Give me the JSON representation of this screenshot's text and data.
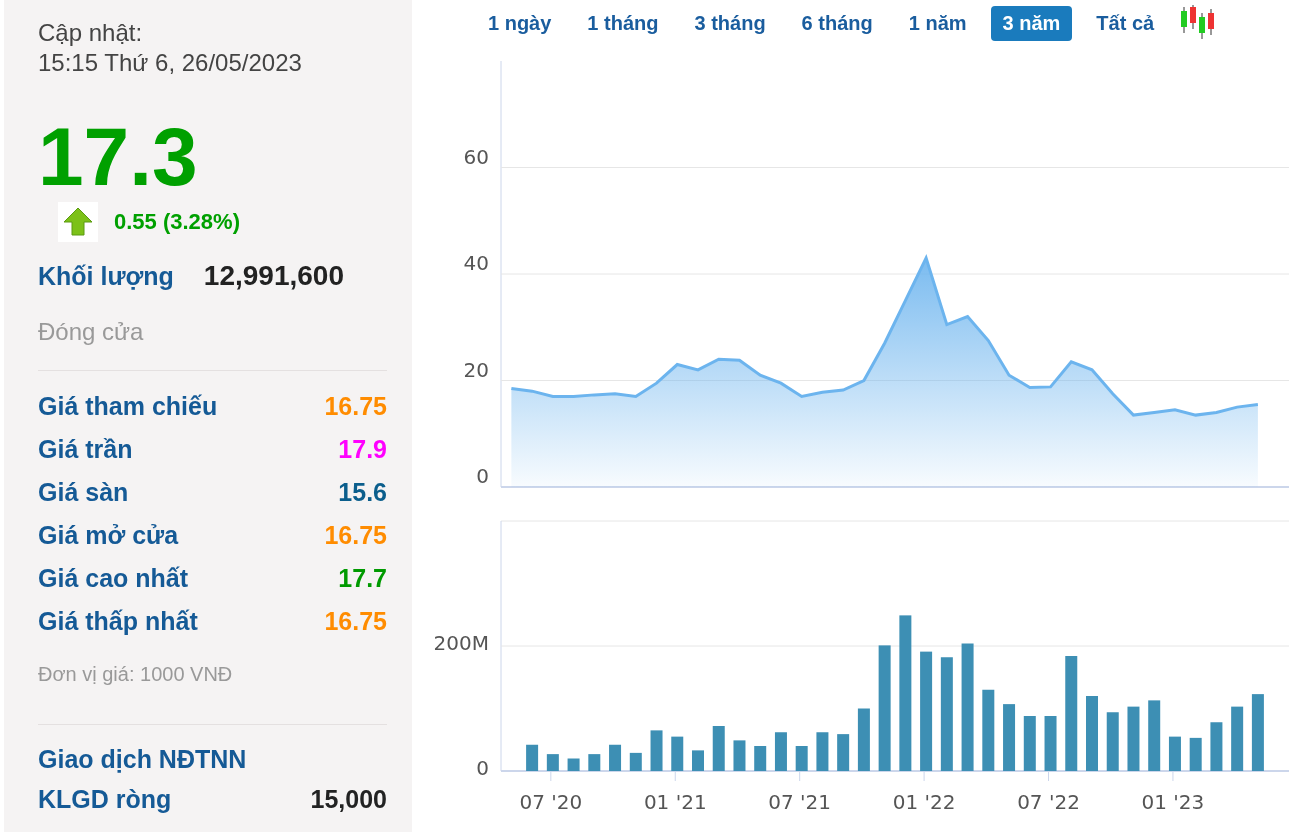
{
  "update": {
    "label": "Cập nhật:",
    "time": "15:15 Thứ 6, 26/05/2023"
  },
  "price": "17.3",
  "change": "0.55 (3.28%)",
  "volume": {
    "label": "Khối lượng",
    "value": "12,991,600"
  },
  "status": "Đóng cửa",
  "prices": [
    {
      "label": "Giá tham chiếu",
      "value": "16.75",
      "color": "#ff8c00"
    },
    {
      "label": "Giá trần",
      "value": "17.9",
      "color": "#ff00ff"
    },
    {
      "label": "Giá sàn",
      "value": "15.6",
      "color": "#0b5e8c"
    },
    {
      "label": "Giá mở cửa",
      "value": "16.75",
      "color": "#ff8c00"
    },
    {
      "label": "Giá cao nhất",
      "value": "17.7",
      "color": "#009a00"
    },
    {
      "label": "Giá thấp nhất",
      "value": "16.75",
      "color": "#ff8c00"
    }
  ],
  "unit_note": "Đơn vị giá: 1000 VNĐ",
  "foreign": {
    "title": "Giao dịch NĐTNN",
    "rows": [
      {
        "label": "KLGD ròng",
        "value": "15,000"
      }
    ]
  },
  "tabs": [
    {
      "label": "1 ngày",
      "selected": false
    },
    {
      "label": "1 tháng",
      "selected": false
    },
    {
      "label": "3 tháng",
      "selected": false
    },
    {
      "label": "6 tháng",
      "selected": false
    },
    {
      "label": "1 năm",
      "selected": false
    },
    {
      "label": "3 năm",
      "selected": true
    },
    {
      "label": "Tất cả",
      "selected": false
    }
  ],
  "price_chart": {
    "chart_data": {
      "type": "area",
      "categories": [
        null,
        null,
        null,
        null,
        null,
        null,
        null,
        null,
        null,
        null,
        null,
        null,
        null,
        null,
        null,
        null,
        null,
        null,
        null,
        null,
        null,
        null,
        null,
        null,
        null,
        null,
        null,
        null,
        null,
        null,
        null,
        null,
        null,
        null,
        null,
        null,
        null
      ],
      "series": [
        {
          "color": "#6cb4ee",
          "values": [
            18.5,
            18,
            17,
            17,
            17.3,
            17.5,
            17,
            19.5,
            23,
            22,
            24,
            23.8,
            21,
            19.5,
            17,
            17.8,
            18.2,
            20,
            27,
            35,
            43,
            30.5,
            32,
            27.5,
            21,
            18.7,
            18.8,
            23.5,
            22,
            17.5,
            13.5,
            14,
            14.5,
            13.5,
            14,
            15,
            15.5
          ]
        }
      ],
      "ylim": [
        0,
        80
      ],
      "yticks": [
        0,
        20,
        40,
        60
      ],
      "grid": true
    }
  },
  "volume_chart": {
    "chart_data": {
      "type": "bar",
      "categories": [
        null,
        "07 '20",
        null,
        null,
        null,
        null,
        null,
        "01 '21",
        null,
        null,
        null,
        null,
        null,
        "07 '21",
        null,
        null,
        null,
        null,
        null,
        "01 '22",
        null,
        null,
        null,
        null,
        null,
        "07 '22",
        null,
        null,
        null,
        null,
        null,
        "01 '23",
        null,
        null,
        null,
        null
      ],
      "series": [
        {
          "color": "#3d8fb4",
          "values": [
            42,
            27,
            20,
            27,
            42,
            29,
            65,
            55,
            33,
            72,
            49,
            40,
            62,
            40,
            62,
            59,
            100,
            201,
            249,
            191,
            182,
            204,
            130,
            107,
            88,
            88,
            184,
            120,
            94,
            103,
            113,
            55,
            53,
            78,
            103,
            123
          ]
        }
      ],
      "ylim": [
        0,
        400
      ],
      "yticks": [
        {
          "value": 0,
          "label": "0"
        },
        {
          "value": 200,
          "label": "200M"
        }
      ],
      "grid": true
    }
  }
}
